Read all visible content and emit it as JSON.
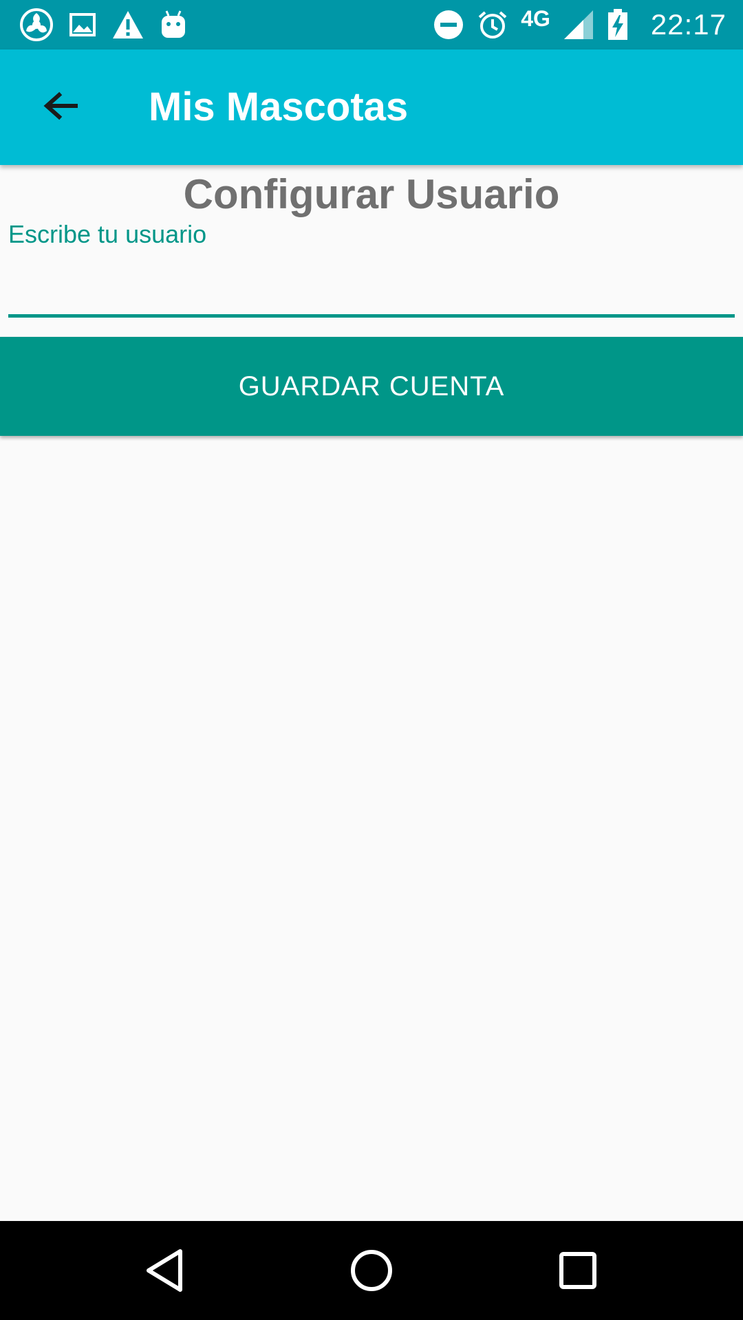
{
  "status_bar": {
    "time": "22:17",
    "network": "4G",
    "left_icons": [
      "app-notification-icon",
      "image-icon",
      "warning-icon",
      "android-icon"
    ],
    "right_icons": [
      "do-not-disturb-icon",
      "alarm-icon",
      "signal-icon",
      "battery-charging-icon"
    ]
  },
  "app_bar": {
    "title": "Mis Mascotas",
    "back_icon": "arrow-back-icon"
  },
  "main": {
    "heading": "Configurar Usuario",
    "username_label": "Escribe tu usuario",
    "username_value": "",
    "save_button": "GUARDAR CUENTA"
  },
  "nav_bar": {
    "buttons": [
      "back-triangle-icon",
      "home-circle-icon",
      "recents-square-icon"
    ]
  },
  "colors": {
    "status_bar": "#0097a7",
    "app_bar": "#00bcd4",
    "accent": "#009688",
    "heading_text": "#707070",
    "background": "#fafafa"
  }
}
